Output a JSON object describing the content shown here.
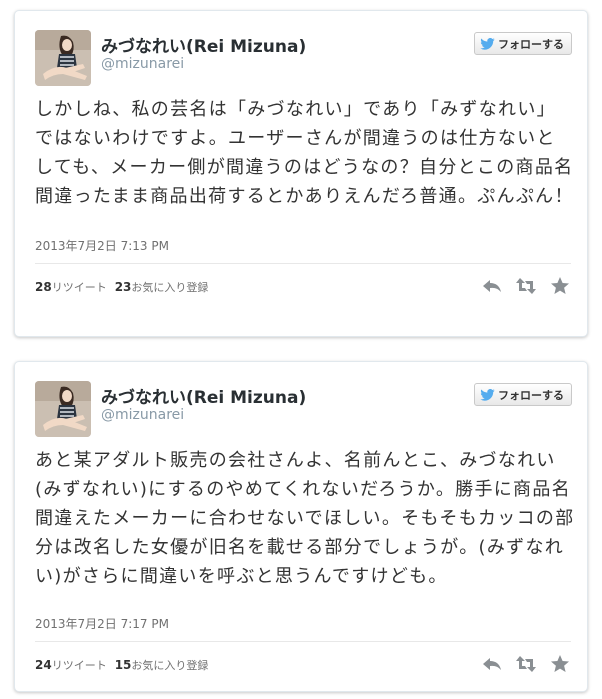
{
  "tweets": [
    {
      "display_name": "みづなれい(Rei Mizuna)",
      "handle": "@mizunarei",
      "follow_label": "フォローする",
      "text": "しかしね、私の芸名は「みづなれい」であり「みずなれい」ではないわけですよ。ユーザーさんが間違うのは仕方ないとしても、メーカー側が間違うのはどうなの？自分とこの商品名間違ったまま商品出荷するとかありえんだろ普通。ぷんぷん！",
      "timestamp": "2013年7月2日 7:13 PM",
      "retweet_count": "28",
      "retweet_label": "リツイート",
      "favorite_count": "23",
      "favorite_label": "お気に入り登録"
    },
    {
      "display_name": "みづなれい(Rei Mizuna)",
      "handle": "@mizunarei",
      "follow_label": "フォローする",
      "text": "あと某アダルト販売の会社さんよ、名前んとこ、みづなれい(みずなれい)にするのやめてくれないだろうか。勝手に商品名間違えたメーカーに合わせないでほしい。そもそもカッコの部分は改名した女優が旧名を載せる部分でしょうが。(みずなれい)がさらに間違いを呼ぶと思うんですけども。",
      "timestamp": "2013年7月2日 7:17 PM",
      "retweet_count": "24",
      "retweet_label": "リツイート",
      "favorite_count": "15",
      "favorite_label": "お気に入り登録"
    }
  ],
  "icons": {
    "follow": "twitter-bird-icon",
    "reply": "reply-icon",
    "retweet": "retweet-icon",
    "favorite": "star-icon"
  },
  "colors": {
    "twitter_blue": "#55acee",
    "action_gray": "#8a8f93",
    "text": "#333333",
    "meta": "#707070"
  }
}
